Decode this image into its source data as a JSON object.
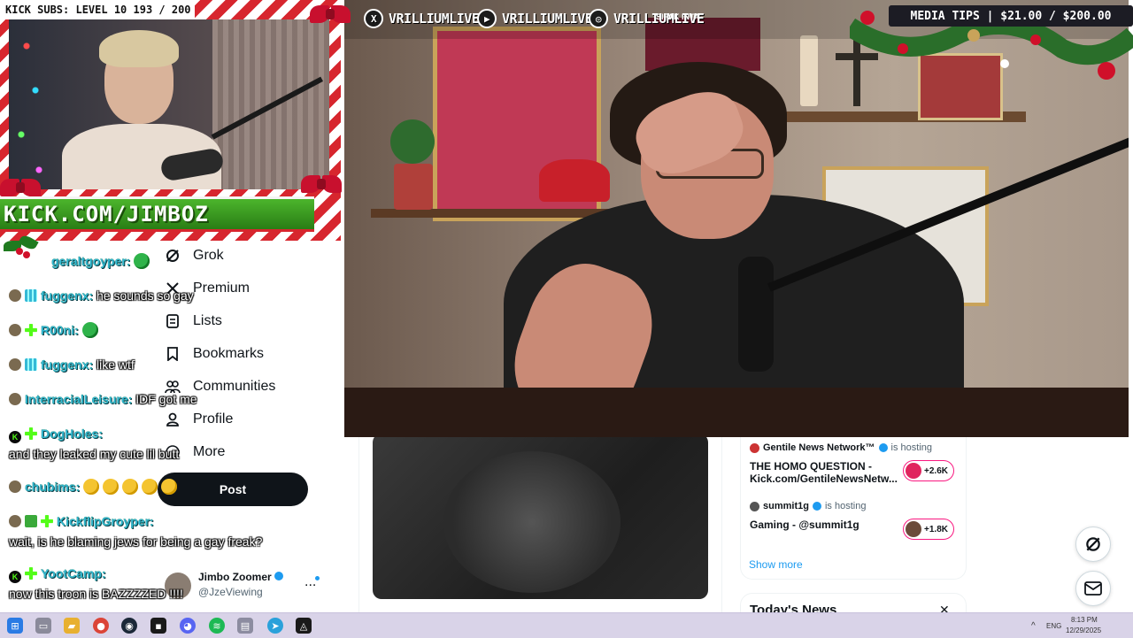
{
  "x_nav": {
    "items": [
      {
        "label": "Grok",
        "icon": "grok-icon"
      },
      {
        "label": "Premium",
        "icon": "x-logo-icon"
      },
      {
        "label": "Lists",
        "icon": "lists-icon"
      },
      {
        "label": "Bookmarks",
        "icon": "bookmark-icon"
      },
      {
        "label": "Communities",
        "icon": "communities-icon"
      },
      {
        "label": "Profile",
        "icon": "profile-icon"
      },
      {
        "label": "More",
        "icon": "more-circle-icon"
      }
    ],
    "post_label": "Post"
  },
  "account": {
    "name": "Jimbo Zoomer",
    "handle": "@JzeViewing",
    "more": "..."
  },
  "live": [
    {
      "host": "Gentile News Network™",
      "status": "is hosting",
      "title": "THE HOMO QUESTION - Kick.com/GentileNewsNetw...",
      "count": "+2.6K"
    },
    {
      "host": "summit1g",
      "status": "is hosting",
      "title": "Gaming - @summit1g",
      "count": "+1.8K"
    }
  ],
  "show_more": "Show more",
  "news": {
    "title": "Today's News",
    "close": "✕"
  },
  "overlay": {
    "subs": "KICK SUBS: LEVEL 10 193 / 200",
    "kick_url": "KICK.COM/JIMBOZ",
    "media_tips": "MEDIA TIPS | $21.00 / $200.00",
    "socials": [
      "VRILLIUMLIVE",
      "VRILLIUMLIVE",
      "VRILLIUMLIVE"
    ],
    "video_top_text": "SIFAK INTA"
  },
  "chat": [
    {
      "user": "geraltgoyper:",
      "text": ""
    },
    {
      "user": "fuggenx:",
      "text": "he sounds so gay"
    },
    {
      "user": "R00ni:",
      "text": ""
    },
    {
      "user": "fuggenx:",
      "text": "like wtf"
    },
    {
      "user": "InterracialLeisure:",
      "text": "IDF got me"
    },
    {
      "user": "DogHoles:",
      "text": ""
    },
    {
      "user": "",
      "text": "and they leaked my cute lil butt"
    },
    {
      "user": "chubims:",
      "text": ""
    },
    {
      "user": "KickflipGroyper:",
      "text": ""
    },
    {
      "user": "",
      "text": "wait, is he blaming jews for being a gay freak?"
    },
    {
      "user": "YootCamp:",
      "text": ""
    },
    {
      "user": "",
      "text": "now this troon is BAZZZZED !!!!"
    }
  ],
  "taskbar": {
    "lang": "ENG",
    "time": "8:13 PM",
    "date": "12/29/2025"
  }
}
